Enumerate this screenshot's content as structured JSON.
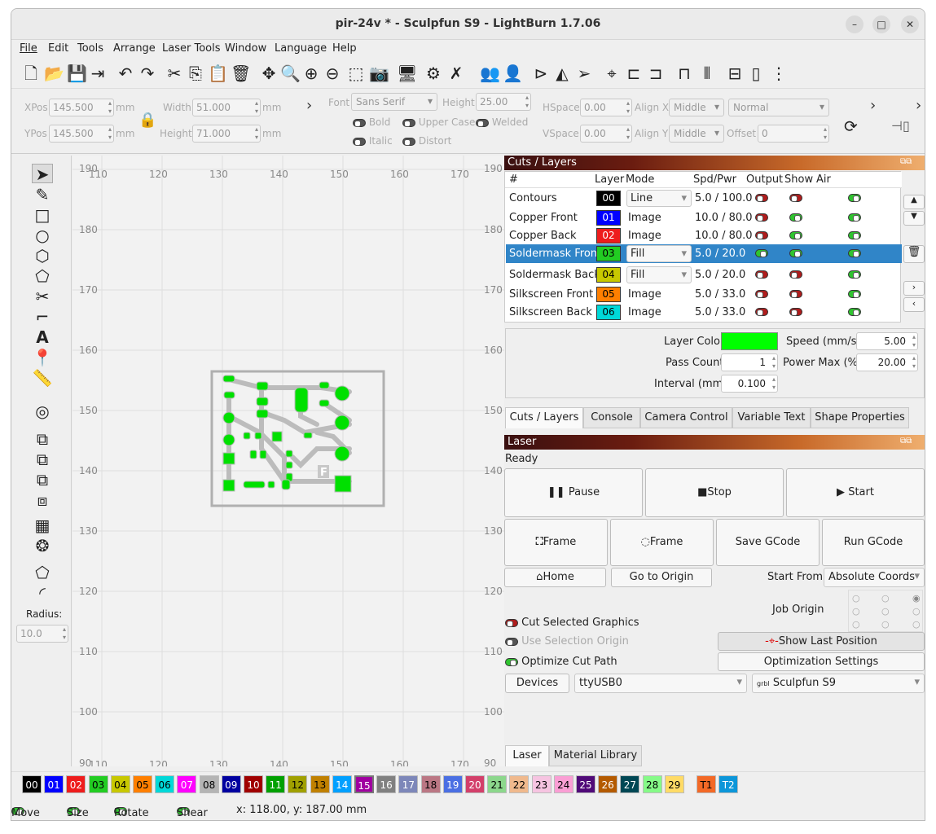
{
  "window": {
    "title": "pir-24v * - Sculpfun S9 - LightBurn 1.7.06"
  },
  "menu": [
    "File",
    "Edit",
    "Tools",
    "Arrange",
    "Laser Tools",
    "Window",
    "Language",
    "Help"
  ],
  "props": {
    "xpos_label": "XPos",
    "xpos": "145.500",
    "ypos_label": "YPos",
    "ypos": "145.500",
    "mm": "mm",
    "width_label": "Width",
    "width": "51.000",
    "height_label": "Height",
    "height": "71.000",
    "font_label": "Font",
    "font": "Sans Serif",
    "fheight_label": "Height",
    "fheight": "25.00",
    "hspace_label": "HSpace",
    "hspace": "0.00",
    "vspace_label": "VSpace",
    "vspace": "0.00",
    "alignx_label": "Align X",
    "alignx": "Middle",
    "aligny_label": "Align Y",
    "aligny": "Middle",
    "normal": "Normal",
    "offset_label": "Offset",
    "offset": "0",
    "bold": "Bold",
    "italic": "Italic",
    "upper": "Upper Case",
    "welded": "Welded",
    "distort": "Distort"
  },
  "left": {
    "radius_label": "Radius:",
    "radius": "10.0"
  },
  "canvas": {
    "top_ticks": [
      "110",
      "120",
      "130",
      "140",
      "150",
      "160",
      "170"
    ],
    "left_ticks": [
      "190",
      "180",
      "170",
      "160",
      "150",
      "140",
      "130",
      "120",
      "110",
      "100",
      "90"
    ],
    "right_ticks": [
      "190",
      "180",
      "170",
      "160",
      "150",
      "140",
      "130",
      "120",
      "110",
      "100",
      "90"
    ],
    "bottom_ticks": [
      "110",
      "120",
      "130",
      "140",
      "150",
      "160",
      "170"
    ],
    "f_mark": "F"
  },
  "cuts": {
    "title": "Cuts / Layers",
    "headers": [
      "#",
      "Layer",
      "Mode",
      "Spd/Pwr",
      "Output",
      "Show",
      "Air"
    ],
    "rows": [
      {
        "name": "Contours",
        "layer": "00",
        "color": "#000000",
        "text": "#ffffff",
        "mode": "Line",
        "spd": "5.0 / 100.0",
        "combo": true
      },
      {
        "name": "Copper Front",
        "layer": "01",
        "color": "#0000ff",
        "text": "#ffffff",
        "mode": "Image",
        "spd": "10.0 / 80.0",
        "combo": false
      },
      {
        "name": "Copper Back",
        "layer": "02",
        "color": "#ee1c1c",
        "text": "#ffffff",
        "mode": "Image",
        "spd": "10.0 / 80.0",
        "combo": false
      },
      {
        "name": "Soldermask Front",
        "layer": "03",
        "color": "#22cc22",
        "text": "#000000",
        "mode": "Fill",
        "spd": "5.0 / 20.0",
        "combo": true
      },
      {
        "name": "Soldermask Back",
        "layer": "04",
        "color": "#c8c800",
        "text": "#000000",
        "mode": "Fill",
        "spd": "5.0 / 20.0",
        "combo": true
      },
      {
        "name": "Silkscreen Front",
        "layer": "05",
        "color": "#ff7f00",
        "text": "#000000",
        "mode": "Image",
        "spd": "5.0 / 33.0",
        "combo": false
      },
      {
        "name": "Silkscreen Back",
        "layer": "06",
        "color": "#00d8d8",
        "text": "#000000",
        "mode": "Image",
        "spd": "5.0 / 33.0",
        "combo": false
      }
    ],
    "layer_color_label": "Layer Color",
    "layer_color": "#00ff00",
    "speed_label": "Speed (mm/s)",
    "speed": "5.00",
    "pass_label": "Pass Count",
    "pass": "1",
    "power_label": "Power Max (%)",
    "power": "20.00",
    "interval_label": "Interval (mm)",
    "interval": "0.100",
    "tabs": [
      "Cuts / Layers",
      "Console",
      "Camera Control",
      "Variable Text",
      "Shape Properties"
    ]
  },
  "laser": {
    "title": "Laser",
    "status": "Ready",
    "pause": "Pause",
    "stop": "Stop",
    "start": "Start",
    "frame1": "Frame",
    "frame2": "Frame",
    "save_gcode": "Save GCode",
    "run_gcode": "Run GCode",
    "home": "Home",
    "go_origin": "Go to Origin",
    "start_from_label": "Start From:",
    "start_from": "Absolute Coords",
    "job_origin": "Job Origin",
    "cut_selected": "Cut Selected Graphics",
    "use_sel_origin": "Use Selection Origin",
    "optimize": "Optimize Cut Path",
    "show_last": "Show Last Position",
    "opt_settings": "Optimization Settings",
    "devices": "Devices",
    "port": "ttyUSB0",
    "machine": "Sculpfun S9",
    "grbl": "grbl",
    "tabs": [
      "Laser",
      "Material Library"
    ]
  },
  "palette": [
    {
      "l": "00",
      "c": "#000000",
      "t": "#fff"
    },
    {
      "l": "01",
      "c": "#0000ff",
      "t": "#fff"
    },
    {
      "l": "02",
      "c": "#ee1c1c",
      "t": "#fff"
    },
    {
      "l": "03",
      "c": "#22cc22",
      "t": "#000"
    },
    {
      "l": "04",
      "c": "#c8c800",
      "t": "#000"
    },
    {
      "l": "05",
      "c": "#ff7f00",
      "t": "#000"
    },
    {
      "l": "06",
      "c": "#00d8d8",
      "t": "#000"
    },
    {
      "l": "07",
      "c": "#ff00ff",
      "t": "#fff"
    },
    {
      "l": "08",
      "c": "#b4b4b4",
      "t": "#000"
    },
    {
      "l": "09",
      "c": "#0000a0",
      "t": "#fff"
    },
    {
      "l": "10",
      "c": "#a00000",
      "t": "#fff"
    },
    {
      "l": "11",
      "c": "#00a000",
      "t": "#fff"
    },
    {
      "l": "12",
      "c": "#a0a000",
      "t": "#000"
    },
    {
      "l": "13",
      "c": "#c08000",
      "t": "#000"
    },
    {
      "l": "14",
      "c": "#00a0ff",
      "t": "#fff"
    },
    {
      "l": "15",
      "c": "#a000a0",
      "t": "#fff"
    },
    {
      "l": "16",
      "c": "#808080",
      "t": "#fff"
    },
    {
      "l": "17",
      "c": "#7d87b9",
      "t": "#fff"
    },
    {
      "l": "18",
      "c": "#bb7784",
      "t": "#000"
    },
    {
      "l": "19",
      "c": "#4a6fe3",
      "t": "#fff"
    },
    {
      "l": "20",
      "c": "#d33f6a",
      "t": "#fff"
    },
    {
      "l": "21",
      "c": "#8cd78c",
      "t": "#000"
    },
    {
      "l": "22",
      "c": "#f0b98d",
      "t": "#000"
    },
    {
      "l": "23",
      "c": "#f6c4e1",
      "t": "#000"
    },
    {
      "l": "24",
      "c": "#fa9ed4",
      "t": "#000"
    },
    {
      "l": "25",
      "c": "#500a78",
      "t": "#fff"
    },
    {
      "l": "26",
      "c": "#b45a00",
      "t": "#fff"
    },
    {
      "l": "27",
      "c": "#004754",
      "t": "#fff"
    },
    {
      "l": "28",
      "c": "#86fa88",
      "t": "#000"
    },
    {
      "l": "29",
      "c": "#ffdb66",
      "t": "#000"
    },
    {
      "l": "T1",
      "c": "#f36926",
      "t": "#000"
    },
    {
      "l": "T2",
      "c": "#0c96d9",
      "t": "#fff"
    }
  ],
  "status": {
    "move": "Move",
    "size": "Size",
    "rotate": "Rotate",
    "shear": "Shear",
    "coords": "x: 118.00, y: 187.00 mm"
  }
}
